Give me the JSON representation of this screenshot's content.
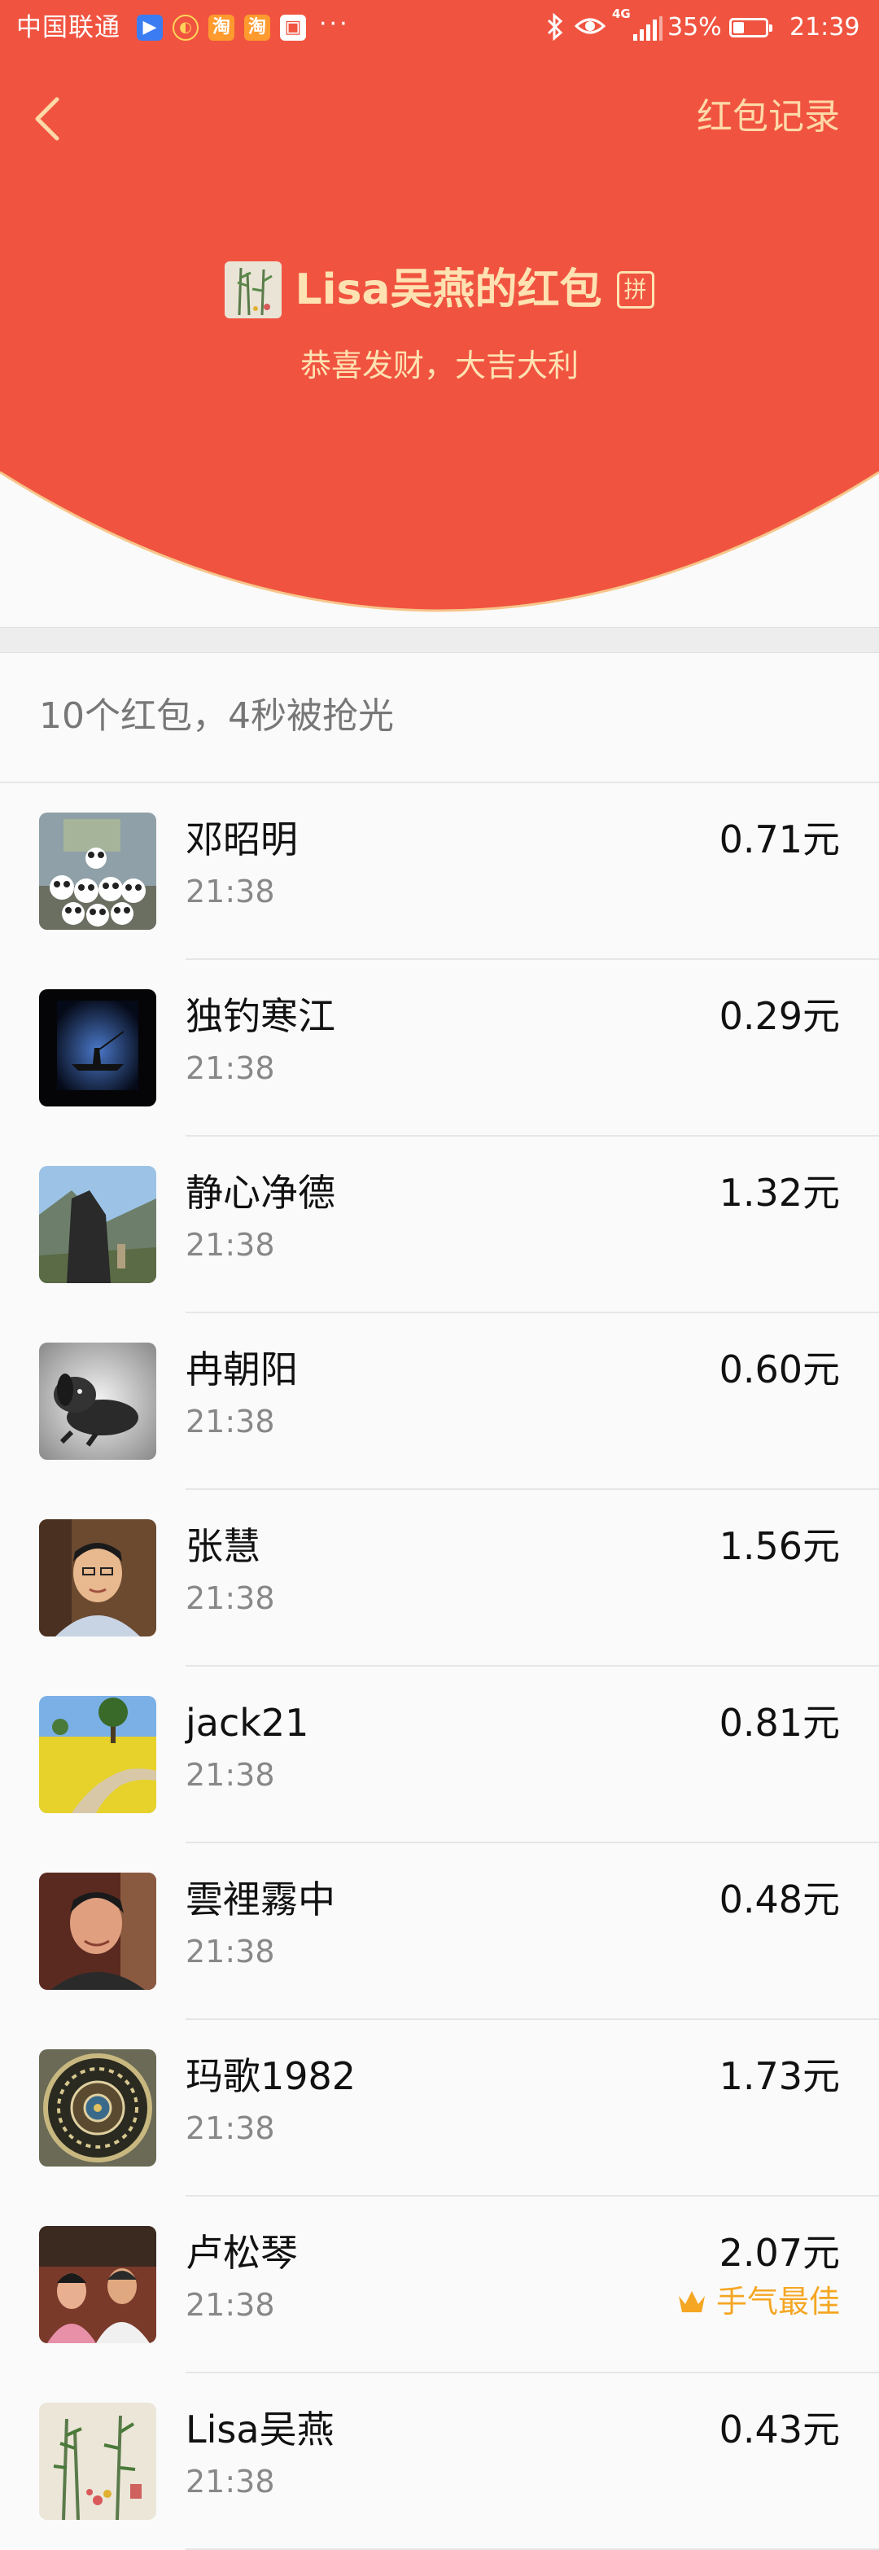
{
  "status_bar": {
    "carrier": "中国联通",
    "network": "4G",
    "battery_percent": "35%",
    "battery_level": 0.35,
    "time": "21:39",
    "icons": [
      "video-app-icon",
      "chat-app-icon",
      "taobao-app-icon",
      "taobao-app-icon",
      "gallery-app-icon",
      "more-dots-icon",
      "bluetooth-icon",
      "eye-icon",
      "signal-icon",
      "battery-icon"
    ]
  },
  "nav": {
    "back_icon": "chevron-left-icon",
    "records_label": "红包记录"
  },
  "header": {
    "title": "Lisa吴燕的红包",
    "pin_badge": "拼",
    "blessing": "恭喜发财，大吉大利",
    "colors": {
      "red": "#f05440",
      "gold_text": "#ffe2b2",
      "arc_border": "#f7c58a"
    }
  },
  "summary": "10个红包，4秒被抢光",
  "list": [
    {
      "name": "邓昭明",
      "time": "21:38",
      "amount": "0.71元",
      "avatar": "panda-group-photo"
    },
    {
      "name": "独钓寒江",
      "time": "21:38",
      "amount": "0.29元",
      "avatar": "night-fishing-photo"
    },
    {
      "name": "静心净德",
      "time": "21:38",
      "amount": "1.32元",
      "avatar": "mountain-rock-photo"
    },
    {
      "name": "冉朝阳",
      "time": "21:38",
      "amount": "0.60元",
      "avatar": "dog-sketch"
    },
    {
      "name": "张慧",
      "time": "21:38",
      "amount": "1.56元",
      "avatar": "man-portrait"
    },
    {
      "name": "jack21",
      "time": "21:38",
      "amount": "0.81元",
      "avatar": "flower-field-photo"
    },
    {
      "name": "雲裡霧中",
      "time": "21:38",
      "amount": "0.48元",
      "avatar": "man-portrait"
    },
    {
      "name": "玛歌1982",
      "time": "21:38",
      "amount": "1.73元",
      "avatar": "mandala-pattern"
    },
    {
      "name": "卢松琴",
      "time": "21:38",
      "amount": "2.07元",
      "avatar": "family-photo",
      "best": "手气最佳"
    },
    {
      "name": "Lisa吴燕",
      "time": "21:38",
      "amount": "0.43元",
      "avatar": "bamboo-painting"
    }
  ]
}
